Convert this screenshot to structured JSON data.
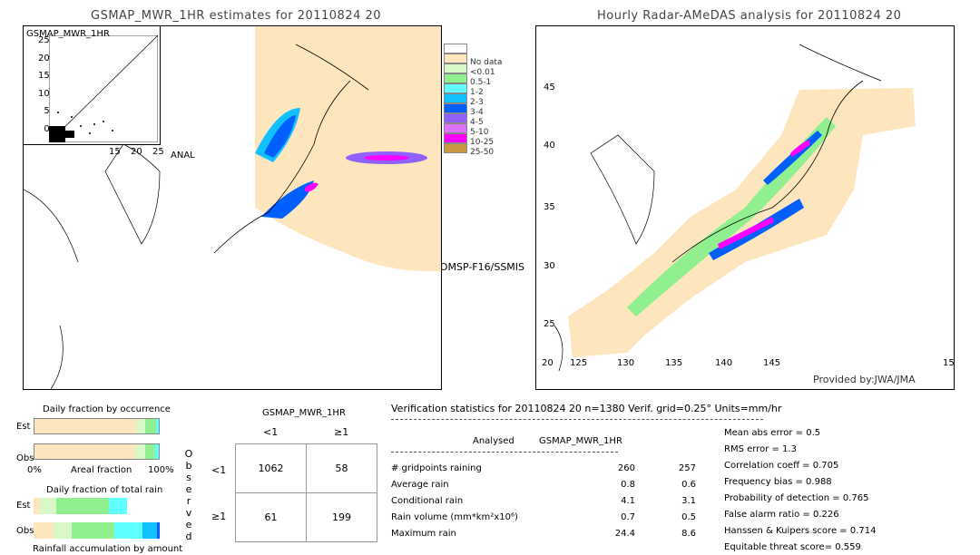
{
  "left_map": {
    "title": "GSMAP_MWR_1HR estimates for 20110824 20",
    "inset_title": "GSMAP_MWR_1HR",
    "inset_y_ticks": [
      "25",
      "20",
      "15",
      "10",
      "5",
      "0"
    ],
    "inset_x_ticks": [
      "15",
      "20",
      "25"
    ],
    "inset_xlabel": "ANAL",
    "sensor_label": "DMSP-F16/SSMIS"
  },
  "right_map": {
    "title": "Hourly Radar-AMeDAS analysis for 20110824 20",
    "lat_ticks": [
      "45",
      "40",
      "35",
      "30",
      "25",
      "20"
    ],
    "lon_ticks": [
      "125",
      "130",
      "135",
      "140",
      "145",
      "15"
    ],
    "credit": "Provided by:JWA/JMA"
  },
  "legend": [
    {
      "label": "",
      "color": "#ffffff"
    },
    {
      "label": "No data",
      "color": "#fde6bd"
    },
    {
      "label": "<0.01",
      "color": "#d8f8c8"
    },
    {
      "label": "0.5-1",
      "color": "#90f090"
    },
    {
      "label": "1-2",
      "color": "#60ffff"
    },
    {
      "label": "2-3",
      "color": "#10c0ff"
    },
    {
      "label": "3-4",
      "color": "#0060ff"
    },
    {
      "label": "4-5",
      "color": "#9060ff"
    },
    {
      "label": "5-10",
      "color": "#e070ff"
    },
    {
      "label": "10-25",
      "color": "#ff00ff"
    },
    {
      "label": "25-50",
      "color": "#c89840"
    }
  ],
  "occurrence": {
    "title": "Daily fraction by occurrence",
    "est_label": "Est",
    "obs_label": "Obs",
    "axis_left": "0%",
    "axis_mid": "Areal fraction",
    "axis_right": "100%",
    "est": [
      0.82,
      0.07,
      0.09,
      0.02
    ],
    "obs": [
      0.81,
      0.08,
      0.08,
      0.03
    ]
  },
  "total_rain": {
    "title": "Daily fraction of total rain",
    "est_label": "Est",
    "obs_label": "Obs",
    "footer": "Rainfall accumulation by amount",
    "est": [
      0.05,
      0.13,
      0.42,
      0.14
    ],
    "obs": [
      0.16,
      0.14,
      0.34,
      0.22,
      0.12,
      0.02
    ]
  },
  "contingency": {
    "title": "GSMAP_MWR_1HR",
    "col_headers": [
      "<1",
      "≥1"
    ],
    "row_headers": [
      "<1",
      "≥1"
    ],
    "side_label": "Observed",
    "cells": [
      [
        "1062",
        "58"
      ],
      [
        "61",
        "199"
      ]
    ]
  },
  "stats": {
    "header": "Verification statistics for 20110824 20  n=1380  Verif. grid=0.25°  Units=mm/hr",
    "col_analysed": "Analysed",
    "col_est": "GSMAP_MWR_1HR",
    "rows": [
      {
        "label": "# gridpoints raining",
        "analysed": "260",
        "est": "257"
      },
      {
        "label": "Average rain",
        "analysed": "0.8",
        "est": "0.6"
      },
      {
        "label": "Conditional rain",
        "analysed": "4.1",
        "est": "3.1"
      },
      {
        "label": "Rain volume (mm*km²x10⁶)",
        "analysed": "0.7",
        "est": "0.5"
      },
      {
        "label": "Maximum rain",
        "analysed": "24.4",
        "est": "8.6"
      }
    ],
    "scores": [
      "Mean abs error = 0.5",
      "RMS error = 1.3",
      "Correlation coeff = 0.705",
      "Frequency bias = 0.988",
      "Probability of detection = 0.765",
      "False alarm ratio = 0.226",
      "Hanssen & Kuipers score = 0.714",
      "Equitable threat score= 0.559"
    ]
  }
}
